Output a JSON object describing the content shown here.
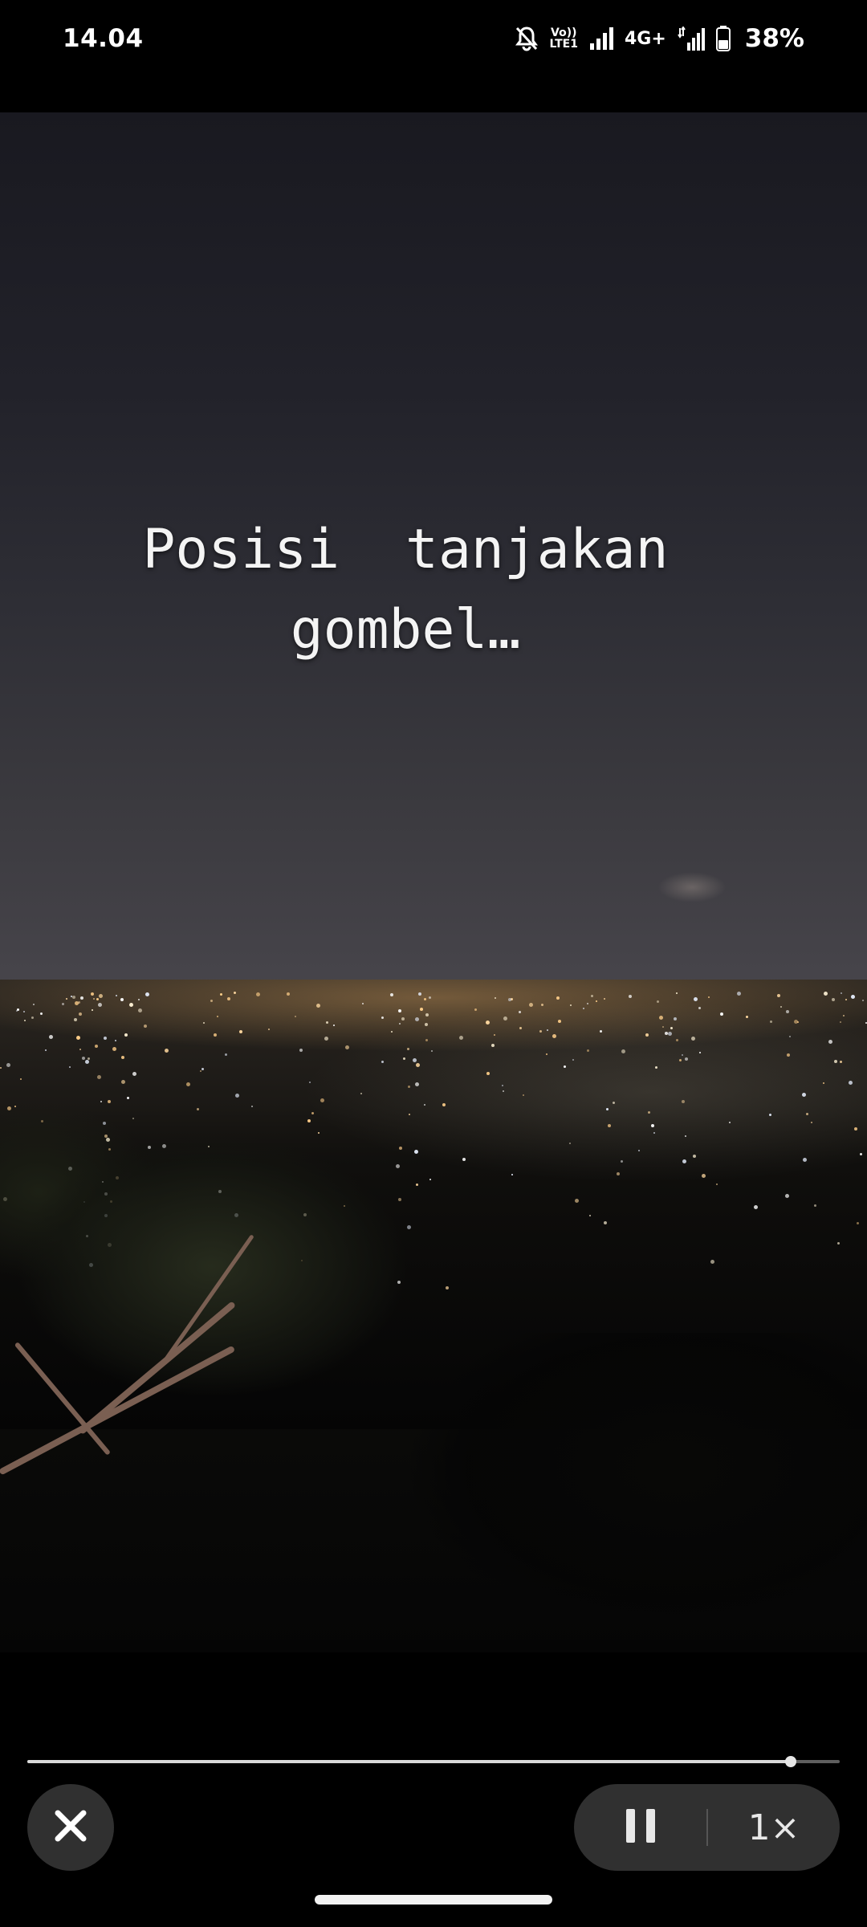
{
  "status_bar": {
    "time": "14.04",
    "volte_top": "Vo))",
    "volte_bottom": "LTE1",
    "network_type": "4G+",
    "battery_percent": "38%"
  },
  "story": {
    "caption": "Posisi  tanjakan\ngombel…"
  },
  "playback": {
    "progress": 0.94,
    "speed_label": "1×"
  }
}
